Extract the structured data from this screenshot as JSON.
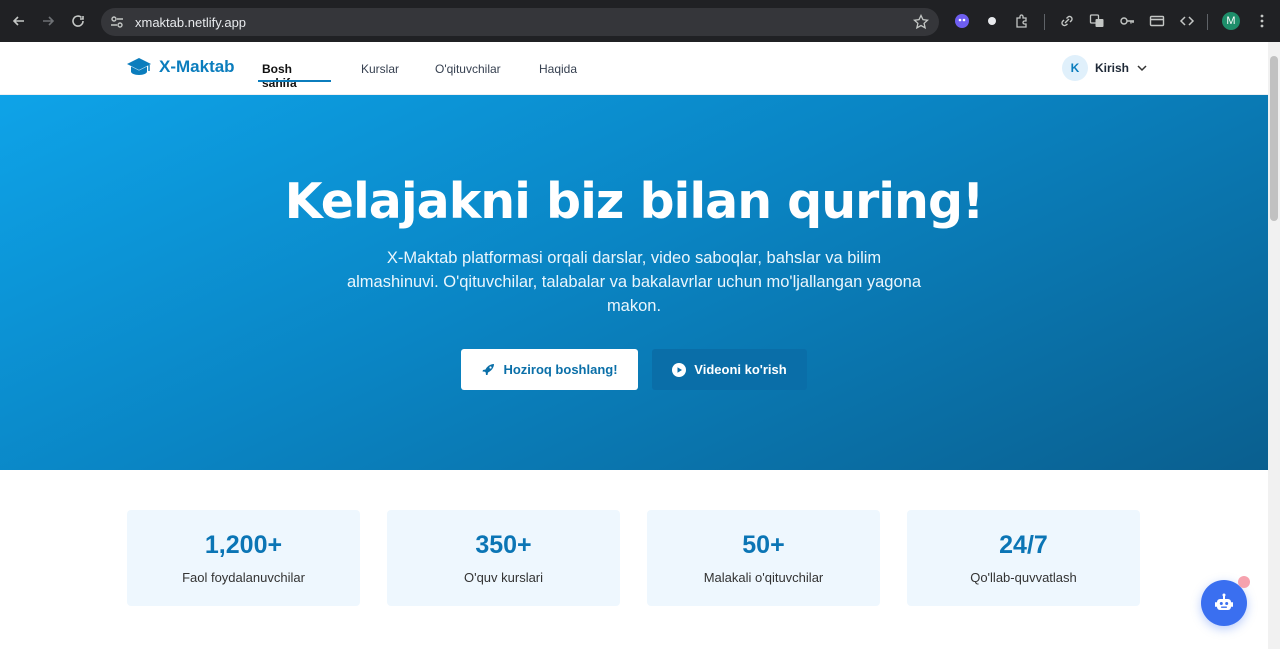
{
  "browser": {
    "url": "xmaktab.netlify.app",
    "profile_initial": "M"
  },
  "site": {
    "logo_text": "X-Maktab",
    "nav": [
      {
        "label": "Bosh sahifa",
        "active": true
      },
      {
        "label": "Kurslar",
        "active": false
      },
      {
        "label": "O'qituvchilar",
        "active": false
      },
      {
        "label": "Haqida",
        "active": false
      }
    ],
    "user": {
      "initial": "K",
      "label": "Kirish"
    }
  },
  "hero": {
    "title": "Kelajakni biz bilan quring!",
    "subtitle": "X-Maktab platformasi orqali darslar, video saboqlar, bahslar va bilim almashinuvi. O'qituvchilar, talabalar va bakalavrlar uchun mo'ljallangan yagona makon.",
    "primary_button": "Hoziroq boshlang!",
    "secondary_button": "Videoni ko'rish"
  },
  "stats": [
    {
      "value": "1,200+",
      "label": "Faol foydalanuvchilar"
    },
    {
      "value": "350+",
      "label": "O'quv kurslari"
    },
    {
      "value": "50+",
      "label": "Malakali o'qituvchilar"
    },
    {
      "value": "24/7",
      "label": "Qo'llab-quvvatlash"
    }
  ],
  "colors": {
    "brand": "#0b7dbd",
    "hero_start": "#0ea3e8",
    "hero_end": "#0a5f8f",
    "stat_bg": "#eef7fe",
    "chatbot": "#3a6ff0"
  }
}
